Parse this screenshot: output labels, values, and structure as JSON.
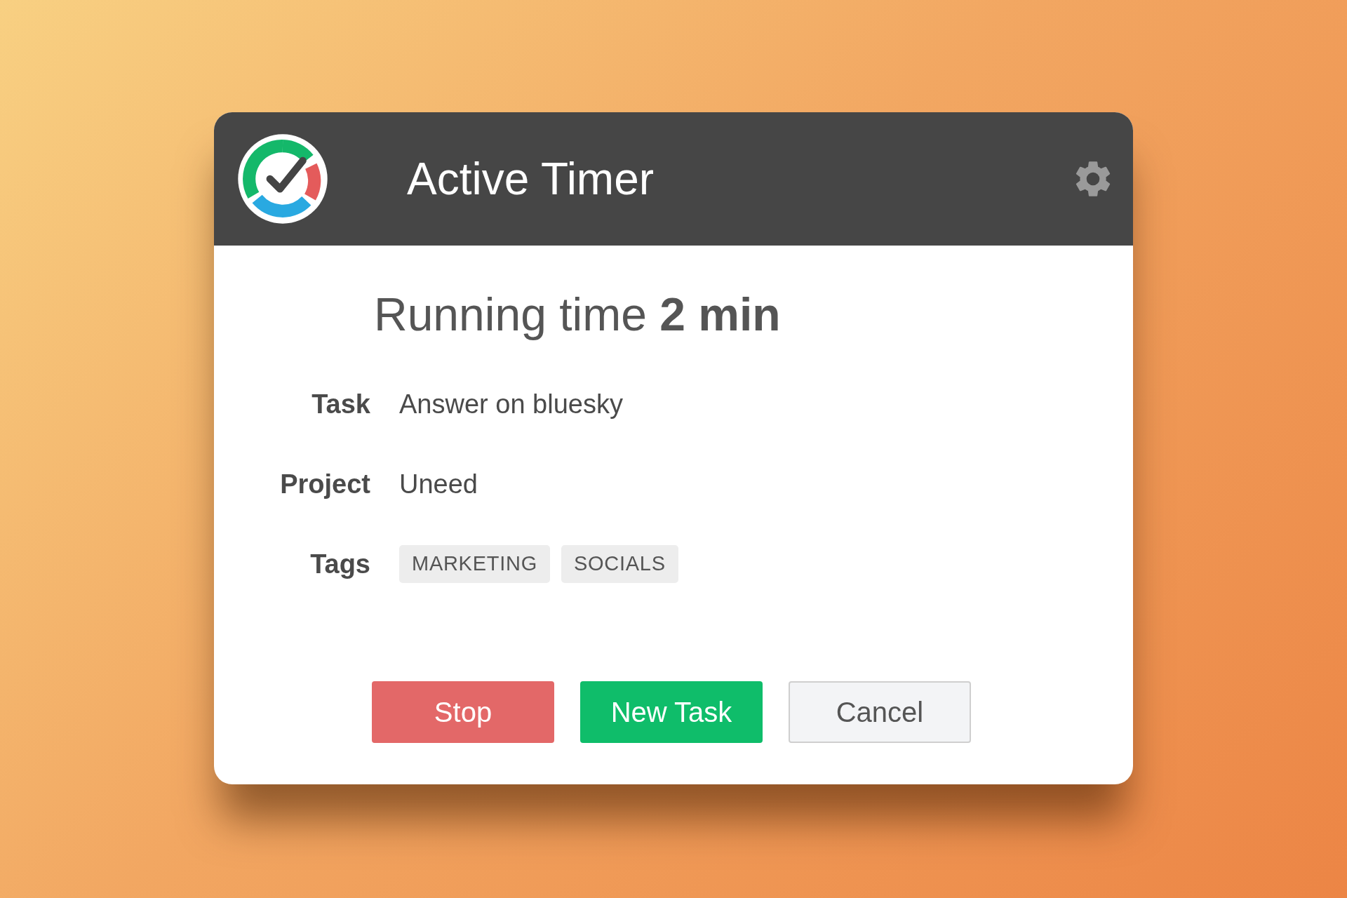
{
  "header": {
    "title": "Active Timer"
  },
  "running_time": "Running time **2 min**",
  "fields": [
    {
      "label": "Task",
      "kind": "text",
      "value": "Answer on bluesky"
    },
    {
      "label": "Project",
      "kind": "text",
      "value": "Uneed"
    },
    {
      "label": "Tags",
      "kind": "tags",
      "tags": [
        "MARKETING",
        "SOCIALS"
      ]
    }
  ],
  "buttons": [
    {
      "label": "Stop",
      "kind": "danger"
    },
    {
      "label": "New Task",
      "kind": "primary"
    },
    {
      "label": "Cancel",
      "kind": "secondary"
    }
  ]
}
